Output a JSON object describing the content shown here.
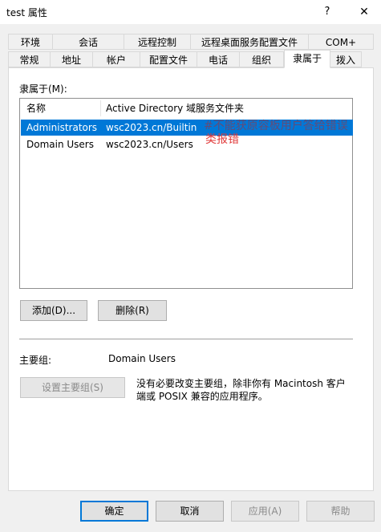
{
  "window": {
    "title": "test 属性",
    "help_icon": "?",
    "close_icon": "✕"
  },
  "tabs_row1": [
    {
      "label": "环境"
    },
    {
      "label": "会话"
    },
    {
      "label": "远程控制"
    },
    {
      "label": "远程桌面服务配置文件"
    },
    {
      "label": "COM+"
    }
  ],
  "tabs_row2": [
    {
      "label": "常规"
    },
    {
      "label": "地址"
    },
    {
      "label": "帐户"
    },
    {
      "label": "配置文件"
    },
    {
      "label": "电话"
    },
    {
      "label": "组织"
    },
    {
      "label": "隶属于"
    },
    {
      "label": "拨入"
    }
  ],
  "active_tab": "隶属于",
  "member_of": {
    "label": "隶属于(M):",
    "columns": [
      "名称",
      "Active Directory 域服务文件夹"
    ],
    "rows": [
      {
        "name": "Administrators",
        "folder": "wsc2023.cn/Builtin",
        "selected": true
      },
      {
        "name": "Domain Users",
        "folder": "wsc2023.cn/Users",
        "selected": false
      }
    ]
  },
  "annotation": {
    "line1": "#不能获原容板用户答给错误",
    "line2": "类报错"
  },
  "buttons": {
    "add": "添加(D)...",
    "remove": "删除(R)"
  },
  "primary_group": {
    "label": "主要组:",
    "value": "Domain Users",
    "set_button": "设置主要组(S)",
    "description": "没有必要改变主要组，除非你有 Macintosh 客户端或 POSIX 兼容的应用程序。"
  },
  "footer": {
    "ok": "确定",
    "cancel": "取消",
    "apply": "应用(A)",
    "help": "帮助"
  },
  "colors": {
    "selection": "#0078d7",
    "annotation": "#e03a3a",
    "primary_border": "#0078d7"
  }
}
